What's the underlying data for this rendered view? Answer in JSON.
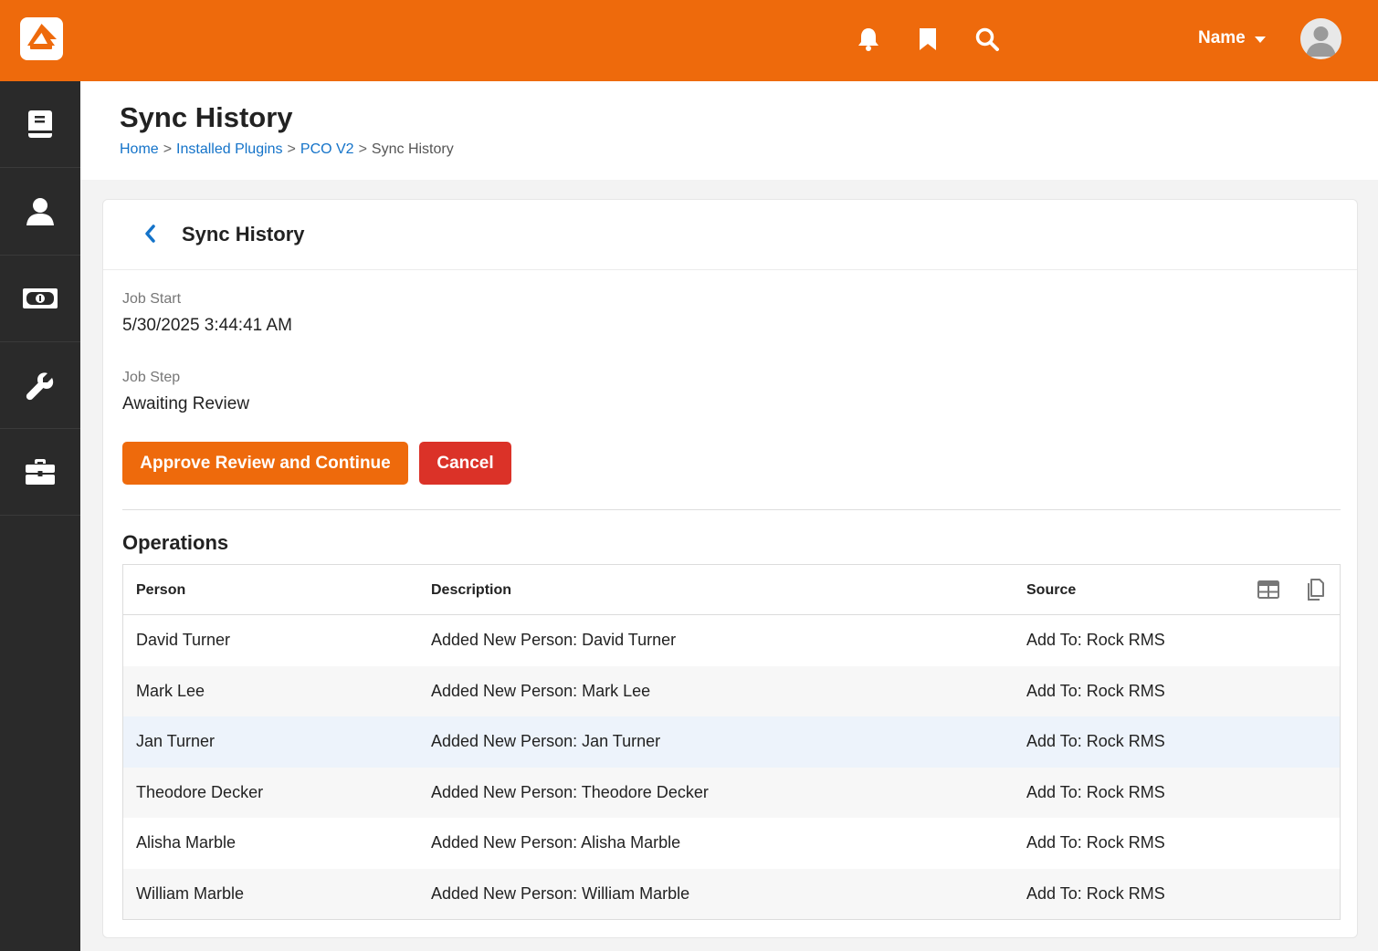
{
  "header": {
    "user_name": "Name",
    "icons": [
      "rock-logo-icon",
      "bell-icon",
      "bookmark-icon",
      "search-icon",
      "caret-down-icon",
      "avatar-icon"
    ],
    "accent_color": "#ee6a0c"
  },
  "sidebar": {
    "items": [
      {
        "icon": "book-icon"
      },
      {
        "icon": "person-icon"
      },
      {
        "icon": "money-icon"
      },
      {
        "icon": "wrench-icon"
      },
      {
        "icon": "briefcase-icon"
      }
    ]
  },
  "page": {
    "title": "Sync History",
    "breadcrumb": {
      "home": "Home",
      "plugins": "Installed Plugins",
      "pco": "PCO V2",
      "current": "Sync History",
      "separator": ">"
    }
  },
  "panel": {
    "title": "Sync History",
    "job_start_label": "Job Start",
    "job_start_value": "5/30/2025 3:44:41 AM",
    "job_step_label": "Job Step",
    "job_step_value": "Awaiting Review",
    "approve_label": "Approve Review and Continue",
    "cancel_label": "Cancel",
    "danger_color": "#db3228"
  },
  "operations": {
    "title": "Operations",
    "columns": {
      "person": "Person",
      "description": "Description",
      "source": "Source"
    },
    "rows": [
      {
        "person": "David Turner",
        "description": "Added New Person: David Turner",
        "source": "Add To: Rock RMS"
      },
      {
        "person": "Mark Lee",
        "description": "Added New Person: Mark Lee",
        "source": "Add To: Rock RMS"
      },
      {
        "person": "Jan Turner",
        "description": "Added New Person: Jan Turner",
        "source": "Add To: Rock RMS"
      },
      {
        "person": "Theodore Decker",
        "description": "Added New Person: Theodore Decker",
        "source": "Add To: Rock RMS"
      },
      {
        "person": "Alisha Marble",
        "description": "Added New Person: Alisha Marble",
        "source": "Add To: Rock RMS"
      },
      {
        "person": "William Marble",
        "description": "Added New Person: William Marble",
        "source": "Add To: Rock RMS"
      }
    ]
  }
}
